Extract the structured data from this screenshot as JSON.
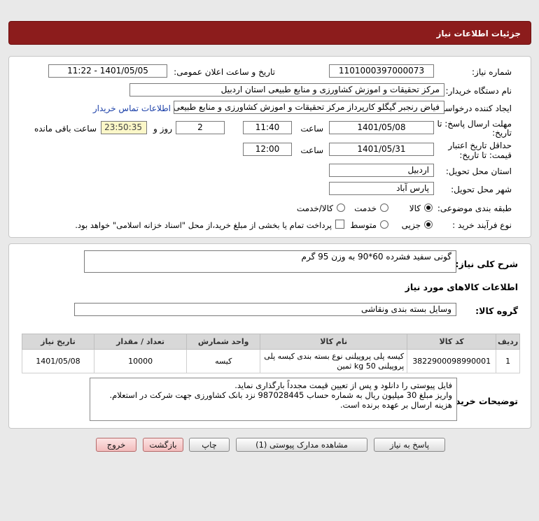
{
  "header": {
    "title": "جزئیات اطلاعات نیاز"
  },
  "form": {
    "need_number": {
      "label": "شماره نیاز:",
      "value": "1101000397000073"
    },
    "announce": {
      "label": "تاریخ و ساعت اعلان عمومی:",
      "value": "1401/05/05 - 11:22"
    },
    "buyer": {
      "label": "نام دستگاه خریدار:",
      "value": "مرکز تحقیقات و اموزش کشاورزی و منابع طبیعی استان اردبیل"
    },
    "creator": {
      "label": "ایجاد کننده درخواست:",
      "value": "فیاض رنجبر گیگلو کارپرداز مرکز تحقیقات و اموزش کشاورزی و منابع طبیعی استان",
      "contact_link": "اطلاعات تماس خریدار"
    },
    "deadline": {
      "label_line1": "مهلت ارسال پاسخ: تا",
      "label_line2": "تاریخ:",
      "date": "1401/05/08",
      "time_label": "ساعت",
      "time": "11:40",
      "days": "2",
      "days_label": "روز و",
      "remaining": "23:50:35",
      "remaining_label": "ساعت باقی مانده"
    },
    "validity": {
      "label_line1": "حداقل تاریخ اعتبار",
      "label_line2": "قیمت: تا تاریخ:",
      "date": "1401/05/31",
      "time_label": "ساعت",
      "time": "12:00"
    },
    "province": {
      "label": "استان محل تحویل:",
      "value": "اردبیل"
    },
    "city": {
      "label": "شهر محل تحویل:",
      "value": "پارس آباد"
    },
    "category": {
      "label": "طبقه بندی موضوعی:",
      "options": [
        "کالا",
        "خدمت",
        "کالا/خدمت"
      ],
      "selected": "کالا"
    },
    "purchase_type": {
      "label": "نوع فرآیند خرید :",
      "options": [
        "جزیی",
        "متوسط"
      ],
      "selected": "جزیی",
      "payment_note": "پرداخت تمام یا بخشی از مبلغ خرید،از محل \"اسناد خزانه اسلامی\" خواهد بود."
    }
  },
  "details": {
    "summary_label": "شرح کلی نیاز:",
    "summary_value": "گونی سفید فشرده 60*90 به وزن 95 گرم",
    "goods_info_title": "اطلاعات کالاهای مورد نیاز",
    "group_label": "گروه کالا:",
    "group_value": "وسایل بسته بندی  ونقاشی",
    "table": {
      "headers": [
        "ردیف",
        "کد کالا",
        "نام کالا",
        "واحد شمارش",
        "تعداد / مقدار",
        "تاریخ نیاز"
      ],
      "rows": [
        {
          "index": "1",
          "code": "3822900098990001",
          "name": "کیسه پلی پروپیلنی نوع بسته بندی کیسه پلی پروپیلنی 50 kg ثمین",
          "unit": "کیسه",
          "qty": "10000",
          "date": "1401/05/08"
        }
      ]
    },
    "notes_label": "توضیحات خریدار:",
    "notes_lines": [
      "فایل پیوستی را دانلود و پس از تعیین قیمت مجدداً بارگذاری نماید.",
      "واریز مبلغ 30 میلیون ریال به شماره حساب 987028445 نزد بانک کشاورزی جهت شرکت در استعلام.",
      "هزینه ارسال بر عهده برنده است."
    ]
  },
  "buttons": {
    "reply": "پاسخ به نیاز",
    "attachments": "مشاهده مدارک پیوستی (1)",
    "print": "چاپ",
    "back": "بازگشت",
    "exit": "خروج"
  }
}
